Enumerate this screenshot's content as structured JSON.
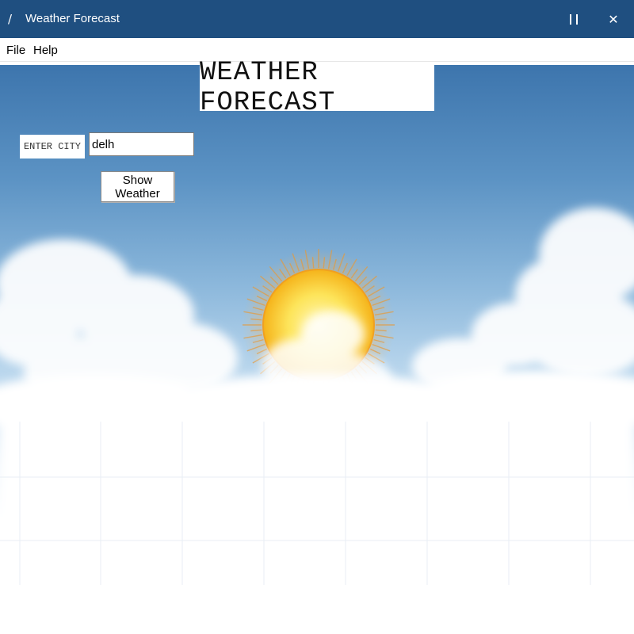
{
  "window": {
    "title": "Weather Forecast",
    "app_icon": "feather-icon",
    "maximize_icon": "maximize-icon",
    "close_icon": "close-icon"
  },
  "menu": {
    "items": [
      {
        "label": "File"
      },
      {
        "label": "Help"
      }
    ]
  },
  "main": {
    "heading": "WEATHER FORECAST",
    "city_label": "ENTER CITY",
    "city_value": "delh",
    "button_label": "Show Weather"
  },
  "colors": {
    "titlebar": "#1f4f80",
    "sky_top": "#3d75ad",
    "sun": "#fbd94a"
  }
}
